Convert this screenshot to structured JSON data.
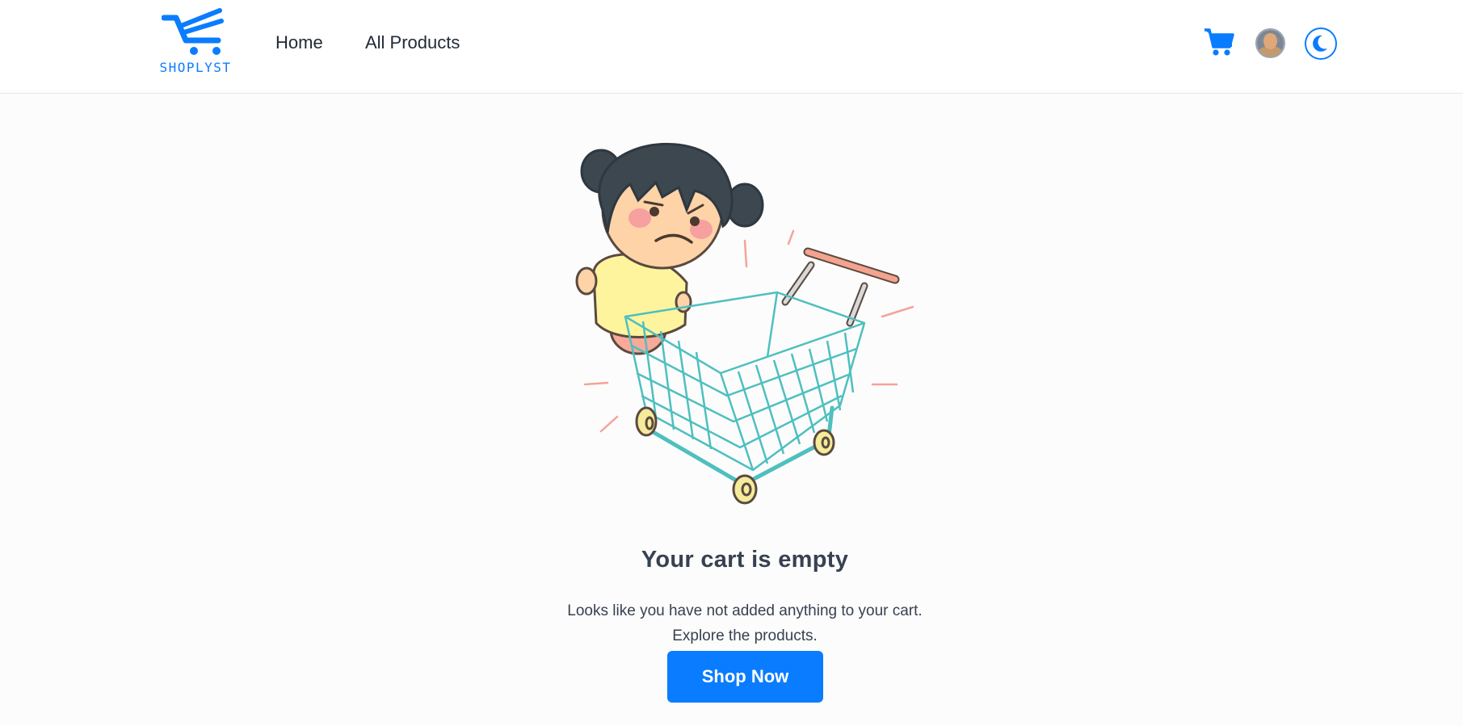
{
  "header": {
    "logo_text": "SHOPLYST",
    "nav": [
      {
        "label": "Home"
      },
      {
        "label": "All Products"
      }
    ]
  },
  "icons": {
    "cart": "cart-icon",
    "avatar": "user-avatar",
    "theme": "moon-icon"
  },
  "colors": {
    "brand": "#0a7cff",
    "text": "#1f2937",
    "muted_text": "#374151",
    "background": "#fcfcfc"
  },
  "empty_state": {
    "title": "Your cart is empty",
    "description_line1": "Looks like you have not added anything to your cart.",
    "description_line2": "Explore the products.",
    "button_label": "Shop Now"
  }
}
